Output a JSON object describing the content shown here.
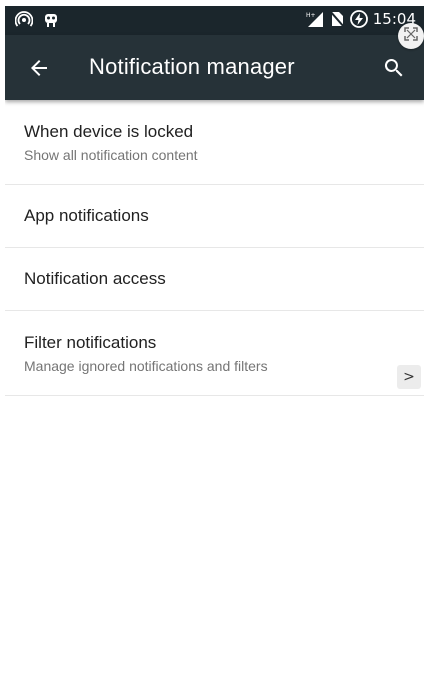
{
  "status_bar": {
    "time": "15:04",
    "icons_left": [
      "hotspot-icon",
      "android-debug-icon"
    ],
    "icons_right": [
      "signal-icon",
      "no-sim-icon",
      "battery-charging-icon"
    ]
  },
  "toolbar": {
    "title": "Notification manager",
    "back_icon": "arrow-back-icon",
    "search_icon": "search-icon",
    "background": "#263238"
  },
  "settings": [
    {
      "title": "When device is locked",
      "summary": "Show all notification content"
    },
    {
      "title": "App notifications"
    },
    {
      "title": "Notification access"
    },
    {
      "title": "Filter notifications",
      "summary": "Manage ignored notifications and filters"
    }
  ],
  "overlay": {
    "chevron": ">",
    "expand_icon": "expand-icon"
  }
}
